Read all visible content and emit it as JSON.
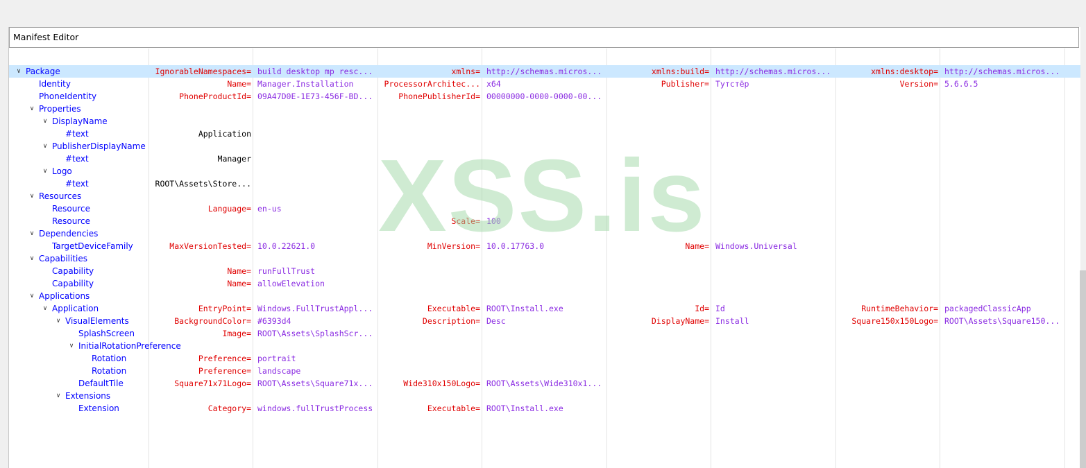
{
  "editor": {
    "title": "Manifest Editor"
  },
  "watermark": "XSS.is",
  "rows": [
    {
      "label": "Package",
      "depth": 0,
      "expanded": true,
      "selected": true,
      "attrs": [
        {
          "name": "IgnorableNamespaces=",
          "value": "build desktop mp resc..."
        },
        {
          "name": "xmlns=",
          "value": "http://schemas.micros..."
        },
        {
          "name": "xmlns:build=",
          "value": "http://schemas.micros..."
        },
        {
          "name": "xmlns:desktop=",
          "value": "http://schemas.micros..."
        }
      ]
    },
    {
      "label": "Identity",
      "depth": 1,
      "attrs": [
        {
          "name": "Name=",
          "value": "Manager.Installation"
        },
        {
          "name": "ProcessorArchitec...",
          "value": "x64"
        },
        {
          "name": "Publisher=",
          "value": "Тутстёр"
        },
        {
          "name": "Version=",
          "value": "5.6.6.5"
        }
      ]
    },
    {
      "label": "PhoneIdentity",
      "depth": 1,
      "attrs": [
        {
          "name": "PhoneProductId=",
          "value": "09A47D0E-1E73-456F-BD..."
        },
        {
          "name": "PhonePublisherId=",
          "value": "00000000-0000-0000-00..."
        }
      ]
    },
    {
      "label": "Properties",
      "depth": 1,
      "expanded": true,
      "attrs": []
    },
    {
      "label": "DisplayName",
      "depth": 2,
      "expanded": true,
      "attrs": []
    },
    {
      "label": "#text",
      "depth": 3,
      "text": "Application",
      "attrs": []
    },
    {
      "label": "PublisherDisplayName",
      "depth": 2,
      "expanded": true,
      "attrs": []
    },
    {
      "label": "#text",
      "depth": 3,
      "text": "Manager",
      "attrs": []
    },
    {
      "label": "Logo",
      "depth": 2,
      "expanded": true,
      "attrs": []
    },
    {
      "label": "#text",
      "depth": 3,
      "text": "ROOT\\Assets\\Store...",
      "attrs": []
    },
    {
      "label": "Resources",
      "depth": 1,
      "expanded": true,
      "attrs": []
    },
    {
      "label": "Resource",
      "depth": 2,
      "attrs": [
        {
          "name": "Language=",
          "value": "en-us"
        }
      ]
    },
    {
      "label": "Resource",
      "depth": 2,
      "attrs": [
        {
          "name": "",
          "value": ""
        },
        {
          "name": "Scale=",
          "value": "100"
        }
      ]
    },
    {
      "label": "Dependencies",
      "depth": 1,
      "expanded": true,
      "attrs": []
    },
    {
      "label": "TargetDeviceFamily",
      "depth": 2,
      "attrs": [
        {
          "name": "MaxVersionTested=",
          "value": "10.0.22621.0"
        },
        {
          "name": "MinVersion=",
          "value": "10.0.17763.0"
        },
        {
          "name": "Name=",
          "value": "Windows.Universal"
        }
      ]
    },
    {
      "label": "Capabilities",
      "depth": 1,
      "expanded": true,
      "attrs": []
    },
    {
      "label": "Capability",
      "depth": 2,
      "attrs": [
        {
          "name": "Name=",
          "value": "runFullTrust"
        }
      ]
    },
    {
      "label": "Capability",
      "depth": 2,
      "attrs": [
        {
          "name": "Name=",
          "value": "allowElevation"
        }
      ]
    },
    {
      "label": "Applications",
      "depth": 1,
      "expanded": true,
      "attrs": []
    },
    {
      "label": "Application",
      "depth": 2,
      "expanded": true,
      "attrs": [
        {
          "name": "EntryPoint=",
          "value": "Windows.FullTrustAppl..."
        },
        {
          "name": "Executable=",
          "value": "ROOT\\Install.exe"
        },
        {
          "name": "Id=",
          "value": "Id"
        },
        {
          "name": "RuntimeBehavior=",
          "value": "packagedClassicApp"
        }
      ]
    },
    {
      "label": "VisualElements",
      "depth": 3,
      "expanded": true,
      "attrs": [
        {
          "name": "BackgroundColor=",
          "value": "#6393d4"
        },
        {
          "name": "Description=",
          "value": "Desc"
        },
        {
          "name": "DisplayName=",
          "value": "Install"
        },
        {
          "name": "Square150x150Logo=",
          "value": "ROOT\\Assets\\Square150..."
        }
      ]
    },
    {
      "label": "SplashScreen",
      "depth": 4,
      "attrs": [
        {
          "name": "Image=",
          "value": "ROOT\\Assets\\SplashScr..."
        }
      ]
    },
    {
      "label": "InitialRotationPreference",
      "depth": 4,
      "expanded": true,
      "attrs": []
    },
    {
      "label": "Rotation",
      "depth": 5,
      "attrs": [
        {
          "name": "Preference=",
          "value": "portrait"
        }
      ]
    },
    {
      "label": "Rotation",
      "depth": 5,
      "attrs": [
        {
          "name": "Preference=",
          "value": "landscape"
        }
      ]
    },
    {
      "label": "DefaultTile",
      "depth": 4,
      "attrs": [
        {
          "name": "Square71x71Logo=",
          "value": "ROOT\\Assets\\Square71x..."
        },
        {
          "name": "Wide310x150Logo=",
          "value": "ROOT\\Assets\\Wide310x1..."
        }
      ]
    },
    {
      "label": "Extensions",
      "depth": 3,
      "expanded": true,
      "attrs": []
    },
    {
      "label": "Extension",
      "depth": 4,
      "attrs": [
        {
          "name": "Category=",
          "value": "windows.fullTrustProcess"
        },
        {
          "name": "Executable=",
          "value": "ROOT\\Install.exe"
        }
      ]
    }
  ]
}
